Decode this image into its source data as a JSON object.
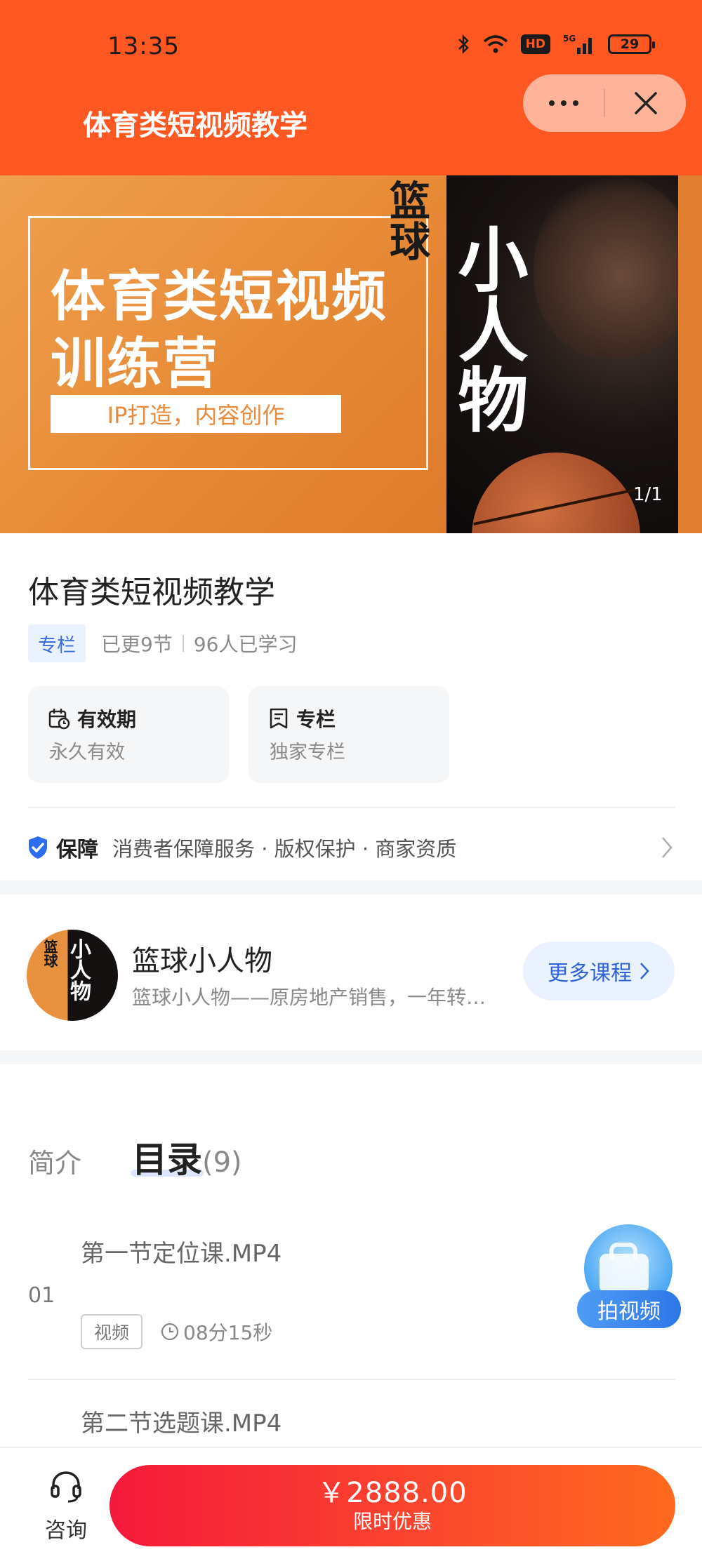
{
  "status_bar": {
    "time": "13:35",
    "hd": "HD",
    "network": "5G",
    "battery": "29"
  },
  "nav": {
    "title": "体育类短视频教学",
    "more_icon": "ellipsis-icon",
    "close_icon": "close-icon"
  },
  "banner": {
    "headline_1": "体育类短视频",
    "headline_2": "训练营",
    "tagline": "IP打造，内容创作",
    "calligraphy_1": "篮球",
    "calligraphy_2": "小人物",
    "indicator": "1/1"
  },
  "course": {
    "title": "体育类短视频教学",
    "tag": "专栏",
    "updated": "已更9节",
    "learners": "96人已学习",
    "features": [
      {
        "icon": "calendar-clock-icon",
        "title": "有效期",
        "subtitle": "永久有效"
      },
      {
        "icon": "column-icon",
        "title": "专栏",
        "subtitle": "独家专栏"
      }
    ],
    "guarantee": {
      "label": "保障",
      "text": "消费者保障服务 · 版权保护 · 商家资质"
    }
  },
  "author": {
    "name": "篮球小人物",
    "description": "篮球小人物——原房地产销售，一年转…",
    "more_button": "更多课程",
    "avatar_calligraphy": "小人物",
    "avatar_calligraphy_small": "篮球"
  },
  "tabs": {
    "intro": "简介",
    "catalog": "目录",
    "catalog_count": "(9)"
  },
  "lessons": [
    {
      "title": "第一节定位课.MP4",
      "number": "01",
      "type": "视频",
      "duration": "08分15秒"
    },
    {
      "title": "第二节选题课.MP4"
    }
  ],
  "float_button": {
    "label": "拍视频"
  },
  "bottom_bar": {
    "consult_label": "咨询",
    "price": "￥2888.00",
    "price_sub": "限时优惠"
  },
  "colors": {
    "header": "#ff5722",
    "accent_blue": "#2f63d8",
    "buy_gradient_start": "#f5193b",
    "buy_gradient_end": "#ff6a1e"
  }
}
